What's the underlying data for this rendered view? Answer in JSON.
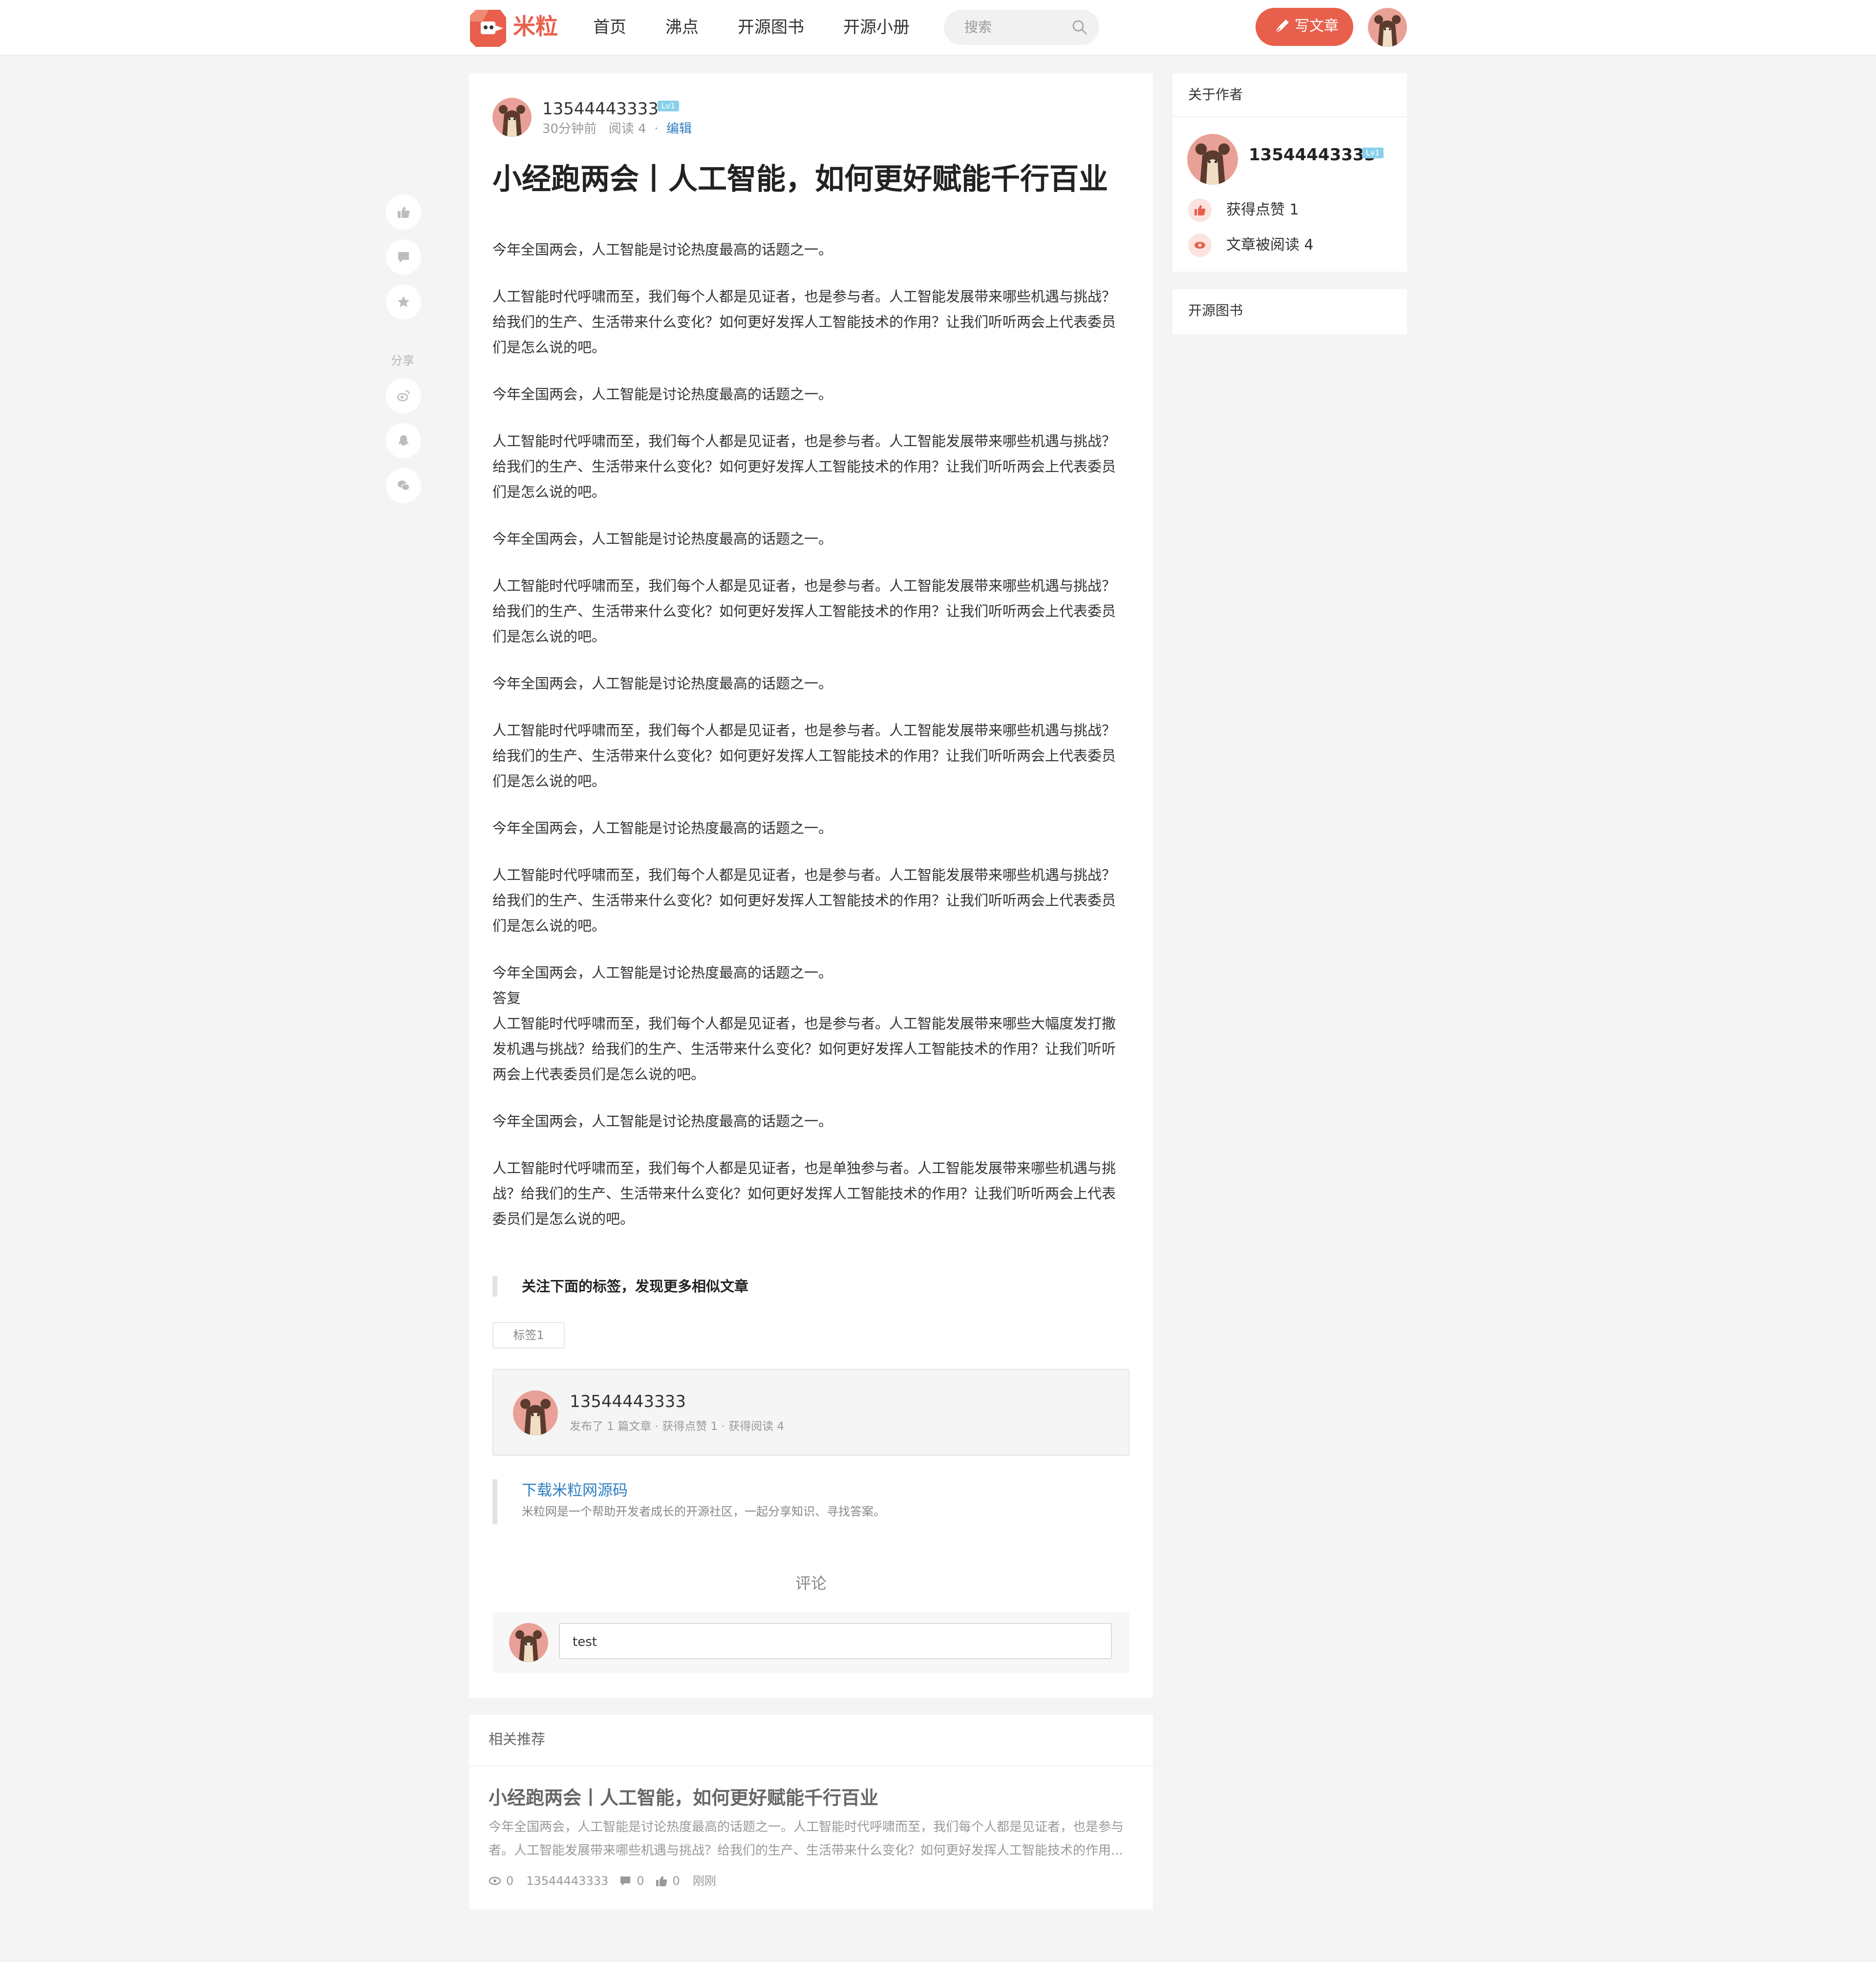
{
  "header": {
    "logo_text": "米粒",
    "nav": [
      "首页",
      "沸点",
      "开源图书",
      "开源小册"
    ],
    "search_placeholder": "搜索",
    "write_label": "写文章",
    "brand_color": "#e8604c"
  },
  "sidebar_actions": {
    "share_label": "分享",
    "icons": [
      "thumbs-up-icon",
      "comment-icon",
      "star-icon",
      "weibo-icon",
      "qq-icon",
      "wechat-icon"
    ]
  },
  "article": {
    "author": "13544443333",
    "level": "Lv1",
    "time": "30分钟前",
    "reads": "阅读 4",
    "dot": "·",
    "edit": "编辑",
    "title": "小经跑两会丨人工智能，如何更好赋能千行百业",
    "paragraphs": [
      "今年全国两会，人工智能是讨论热度最高的话题之一。",
      "人工智能时代呼啸而至，我们每个人都是见证者，也是参与者。人工智能发展带来哪些机遇与挑战？给我们的生产、生活带来什么变化？如何更好发挥人工智能技术的作用？让我们听听两会上代表委员们是怎么说的吧。",
      "今年全国两会，人工智能是讨论热度最高的话题之一。",
      "人工智能时代呼啸而至，我们每个人都是见证者，也是参与者。人工智能发展带来哪些机遇与挑战？给我们的生产、生活带来什么变化？如何更好发挥人工智能技术的作用？让我们听听两会上代表委员们是怎么说的吧。",
      "今年全国两会，人工智能是讨论热度最高的话题之一。",
      "人工智能时代呼啸而至，我们每个人都是见证者，也是参与者。人工智能发展带来哪些机遇与挑战？给我们的生产、生活带来什么变化？如何更好发挥人工智能技术的作用？让我们听听两会上代表委员们是怎么说的吧。",
      "今年全国两会，人工智能是讨论热度最高的话题之一。",
      "人工智能时代呼啸而至，我们每个人都是见证者，也是参与者。人工智能发展带来哪些机遇与挑战？给我们的生产、生活带来什么变化？如何更好发挥人工智能技术的作用？让我们听听两会上代表委员们是怎么说的吧。",
      "今年全国两会，人工智能是讨论热度最高的话题之一。",
      "人工智能时代呼啸而至，我们每个人都是见证者，也是参与者。人工智能发展带来哪些机遇与挑战？给我们的生产、生活带来什么变化？如何更好发挥人工智能技术的作用？让我们听听两会上代表委员们是怎么说的吧。",
      "今年全国两会，人工智能是讨论热度最高的话题之一。\n答复\n人工智能时代呼啸而至，我们每个人都是见证者，也是参与者。人工智能发展带来哪些大幅度发打撒发机遇与挑战？给我们的生产、生活带来什么变化？如何更好发挥人工智能技术的作用？让我们听听两会上代表委员们是怎么说的吧。",
      "今年全国两会，人工智能是讨论热度最高的话题之一。",
      "人工智能时代呼啸而至，我们每个人都是见证者，也是单独参与者。人工智能发展带来哪些机遇与挑战？给我们的生产、生活带来什么变化？如何更好发挥人工智能技术的作用？让我们听听两会上代表委员们是怎么说的吧。"
    ],
    "tags_heading": "关注下面的标签，发现更多相似文章",
    "tags": [
      "标签1"
    ],
    "author_box": {
      "name": "13544443333",
      "stats": "发布了 1 篇文章 · 获得点赞 1 · 获得阅读 4"
    },
    "download": {
      "link": "下载米粒网源码",
      "desc": "米粒网是一个帮助开发者成长的开源社区，一起分享知识、寻找答案。"
    },
    "comment_heading": "评论",
    "comment_value": "test"
  },
  "related": {
    "header": "相关推荐",
    "title": "小经跑两会丨人工智能，如何更好赋能千行百业",
    "excerpt": "今年全国两会，人工智能是讨论热度最高的话题之一。人工智能时代呼啸而至，我们每个人都是见证者，也是参与者。人工智能发展带来哪些机遇与挑战？给我们的生产、生活带来什么变化？如何更好发挥人工智能技术的作用...",
    "views": "0",
    "author": "13544443333",
    "comments": "0",
    "likes": "0",
    "time": "刚刚"
  },
  "side": {
    "about_title": "关于作者",
    "name": "13544443333",
    "level": "Lv1",
    "likes": "获得点赞 1",
    "reads": "文章被阅读 4",
    "books_title": "开源图书"
  }
}
